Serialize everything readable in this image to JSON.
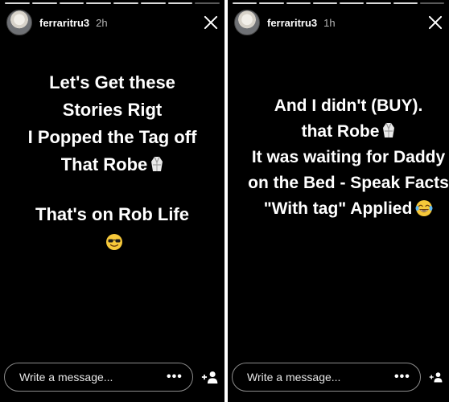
{
  "stories": [
    {
      "username": "ferraritru3",
      "time": "2h",
      "progress_segments": 8,
      "active_segment_index": 7,
      "lines": [
        "Let's Get these",
        "Stories Rigt",
        "I Popped the Tag off",
        "That Robe"
      ],
      "line2": "That's on Rob Life",
      "emoji_icon": "smiling-face-with-sunglasses",
      "robe_icon": "robe-emoji",
      "message_placeholder": "Write a message...",
      "more_label": "•••"
    },
    {
      "username": "ferraritru3",
      "time": "1h",
      "progress_segments": 8,
      "active_segment_index": 7,
      "lines": [
        "And I didn't (BUY).",
        "that Robe",
        "It was waiting for Daddy",
        "on the Bed - Speak Facts",
        "\"With tag\" Applied"
      ],
      "emoji_icon": "face-with-tears-of-joy",
      "robe_icon": "robe-emoji",
      "message_placeholder": "Write a message...",
      "more_label": "•••"
    }
  ],
  "colors": {
    "background": "#000000",
    "text": "#ffffff",
    "timestamp": "#b5b5b5",
    "emoji_yellow": "#f6c83a"
  }
}
